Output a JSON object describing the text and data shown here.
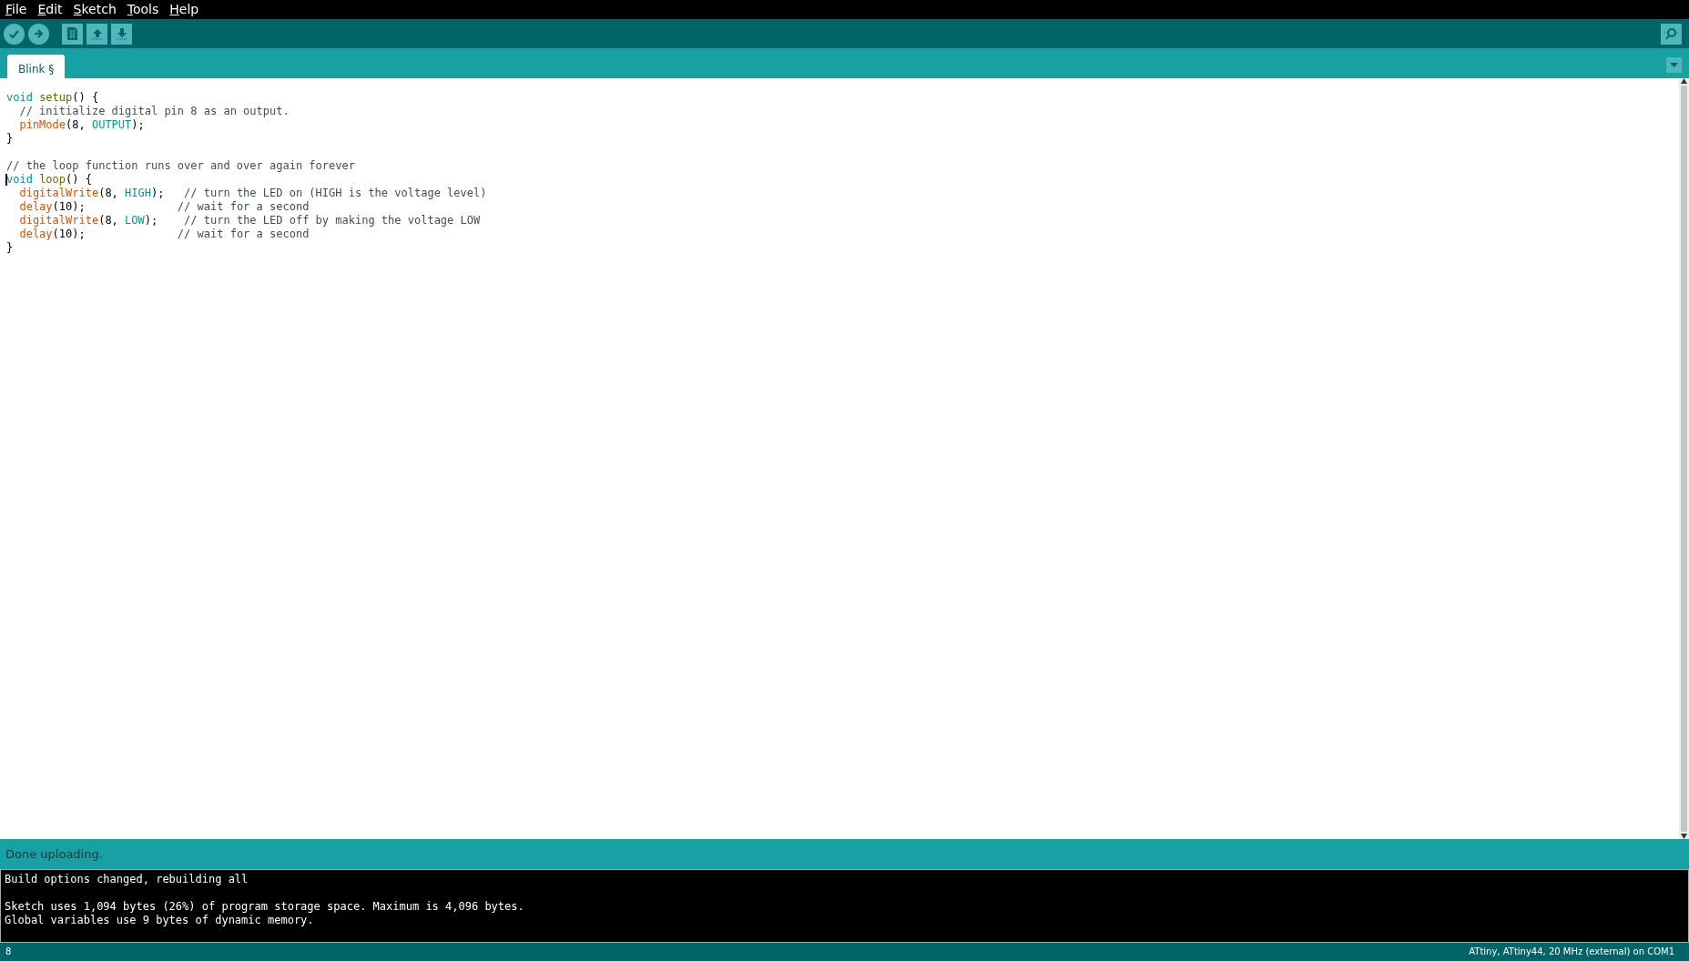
{
  "menu": [
    {
      "label": "File"
    },
    {
      "label": "Edit"
    },
    {
      "label": "Sketch"
    },
    {
      "label": "Tools"
    },
    {
      "label": "Help"
    }
  ],
  "tabs": [
    {
      "label": "Blink §",
      "selected": true
    }
  ],
  "editor": {
    "lines": [
      {
        "cursor": false,
        "tokens": [
          {
            "kind": "keyword",
            "text": "void"
          },
          {
            "kind": "structure",
            "text": " setup"
          },
          {
            "kind": "plain",
            "text": "() {"
          }
        ]
      },
      {
        "cursor": false,
        "tokens": [
          {
            "kind": "comment",
            "text": "  // initialize digital pin 8 as an output."
          }
        ]
      },
      {
        "cursor": false,
        "tokens": [
          {
            "kind": "function",
            "text": "  pinMode"
          },
          {
            "kind": "plain",
            "text": "(8, "
          },
          {
            "kind": "constant",
            "text": "OUTPUT"
          },
          {
            "kind": "plain",
            "text": ");"
          }
        ]
      },
      {
        "cursor": false,
        "tokens": [
          {
            "kind": "plain",
            "text": "}"
          }
        ]
      },
      {
        "cursor": false
      },
      {
        "cursor": false,
        "tokens": [
          {
            "kind": "comment",
            "text": "// the loop function runs over and over again forever"
          }
        ]
      },
      {
        "cursor": true,
        "tokens": [
          {
            "kind": "keyword",
            "text": "void"
          },
          {
            "kind": "structure",
            "text": " loop"
          },
          {
            "kind": "plain",
            "text": "() {"
          }
        ]
      },
      {
        "cursor": false,
        "tokens": [
          {
            "kind": "function",
            "text": "  digitalWrite"
          },
          {
            "kind": "plain",
            "text": "(8, "
          },
          {
            "kind": "constant",
            "text": "HIGH"
          },
          {
            "kind": "plain",
            "text": ");   "
          },
          {
            "kind": "comment",
            "text": "// turn the LED on (HIGH is the voltage level)"
          }
        ]
      },
      {
        "cursor": false,
        "tokens": [
          {
            "kind": "function",
            "text": "  delay"
          },
          {
            "kind": "plain",
            "text": "(10);              "
          },
          {
            "kind": "comment",
            "text": "// wait for a second"
          }
        ]
      },
      {
        "cursor": false,
        "tokens": [
          {
            "kind": "function",
            "text": "  digitalWrite"
          },
          {
            "kind": "plain",
            "text": "(8, "
          },
          {
            "kind": "constant",
            "text": "LOW"
          },
          {
            "kind": "plain",
            "text": ");    "
          },
          {
            "kind": "comment",
            "text": "// turn the LED off by making the voltage LOW"
          }
        ]
      },
      {
        "cursor": false,
        "tokens": [
          {
            "kind": "function",
            "text": "  delay"
          },
          {
            "kind": "plain",
            "text": "(10);              "
          },
          {
            "kind": "comment",
            "text": "// wait for a second"
          }
        ]
      },
      {
        "cursor": false,
        "tokens": [
          {
            "kind": "plain",
            "text": "}"
          }
        ]
      }
    ]
  },
  "status": "Done uploading.",
  "console": [
    [
      "Build options changed, rebuilding all"
    ],
    [
      "Sketch uses 1,094 bytes (26%) of program storage space. Maximum is 4,096 bytes.",
      "Global variables use 9 bytes of dynamic memory."
    ]
  ],
  "footer": {
    "line_number": "8",
    "board": "ATtiny, ATtiny44, 20 MHz (external) on COM1"
  }
}
